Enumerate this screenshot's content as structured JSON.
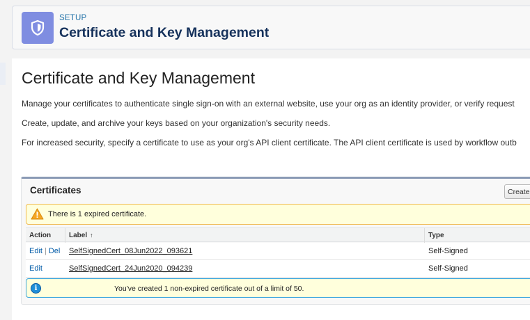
{
  "header": {
    "eyebrow": "SETUP",
    "title": "Certificate and Key Management",
    "icon": "shield-icon",
    "icon_color": "#7f8de1"
  },
  "main": {
    "title": "Certificate and Key Management",
    "descriptions": [
      "Manage your certificates to authenticate single sign-on with an external website, use your org as an identity provider, or verify request",
      "Create, update, and archive your keys based on your organization's security needs.",
      "For increased security, specify a certificate to use as your org's API client certificate. The API client certificate is used by workflow outb"
    ]
  },
  "certificates": {
    "title": "Certificates",
    "create_button": "Create",
    "warning": "There is 1 expired certificate.",
    "columns": {
      "action": "Action",
      "label": "Label",
      "label_sort": "↑",
      "type": "Type"
    },
    "rows": [
      {
        "actions": [
          "Edit",
          "Del"
        ],
        "label": "SelfSignedCert_08Jun2022_093621",
        "type": "Self-Signed"
      },
      {
        "actions": [
          "Edit"
        ],
        "label": "SelfSignedCert_24Jun2020_094239",
        "type": "Self-Signed"
      }
    ],
    "action_separator": "|",
    "info": "You've created 1 non-expired certificate out of a limit of 50."
  },
  "colors": {
    "link": "#015ba7",
    "warning_border": "#f0ba4f",
    "info_border": "#39a5dd",
    "panel_accent": "#8a9ab5"
  }
}
